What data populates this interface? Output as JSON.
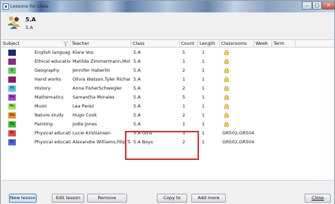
{
  "window": {
    "title": "Lessons for class"
  },
  "header": {
    "title": "5.A",
    "subtitle": "5.A"
  },
  "columns": [
    "Subject",
    "Teacher",
    "Class",
    "Count",
    "Length",
    "Classrooms",
    "Week",
    "Term"
  ],
  "rows": [
    {
      "abbr": "",
      "color": "#1a2b7a",
      "subject": "English language",
      "teacher": "Klara Vos",
      "class": "5.A",
      "count": "5",
      "length": "1",
      "classrooms": ""
    },
    {
      "abbr": "",
      "color": "#8a2a8a",
      "subject": "Ethical education",
      "teacher": "Matilda Zimmermann,Mollie ...",
      "class": "5.A",
      "count": "1",
      "length": "1",
      "classrooms": ""
    },
    {
      "abbr": "G",
      "color": "#5bd05b",
      "subject": "Geography",
      "teacher": "Jennifer Haberlin",
      "class": "5.A",
      "count": "2",
      "length": "1",
      "classrooms": ""
    },
    {
      "abbr": "",
      "color": "#8a1a6a",
      "subject": "Hand works",
      "teacher": "Olivia Watson,Tyler Richards",
      "class": "5.A",
      "count": "1",
      "length": "1",
      "classrooms": ""
    },
    {
      "abbr": "Hi",
      "color": "#48c8e8",
      "subject": "History",
      "teacher": "Anna FisherSchwegler",
      "class": "5.A",
      "count": "2",
      "length": "1",
      "classrooms": ""
    },
    {
      "abbr": "Ma",
      "color": "#b040d8",
      "subject": "Mathematics",
      "teacher": "Samantha Morales",
      "class": "5.A",
      "count": "5",
      "length": "1",
      "classrooms": ""
    },
    {
      "abbr": "Mu",
      "color": "#9aea5a",
      "subject": "Music",
      "teacher": "Lea Perez",
      "class": "5.A",
      "count": "1",
      "length": "1",
      "classrooms": ""
    },
    {
      "abbr": "Na",
      "color": "#f08a20",
      "subject": "Nature study",
      "teacher": "Hugo Cook",
      "class": "5.A",
      "count": "2",
      "length": "1",
      "classrooms": ""
    },
    {
      "abbr": "Pa",
      "color": "#30c030",
      "subject": "Painting",
      "teacher": "Jodie Jones",
      "class": "5.A",
      "count": "1",
      "length": "1",
      "classrooms": ""
    },
    {
      "abbr": "Ph",
      "color": "#e84a4a",
      "subject": "Physical education",
      "teacher": "Lucie Kristiansen",
      "class": "5.A Girls",
      "count": "3",
      "length": "1",
      "classrooms": "GR502,GR504"
    },
    {
      "abbr": "Ph",
      "color": "#4a6ae8",
      "subject": "Physical education",
      "teacher": "Alexandre Williams,Filip Taylo",
      "class": "5.A Boys",
      "count": "2",
      "length": "1",
      "classrooms": "GR502,GR504"
    }
  ],
  "buttons": {
    "new_lesson": "New lesson",
    "edit_lesson": "Edit lesson",
    "remove": "Remove",
    "copy_to": "Copy to",
    "add_more": "Add more",
    "close": "Close"
  },
  "icons": {
    "window": "window-icon",
    "classes": "group-avatar-icon",
    "filter": "filter-icon",
    "classroom_lock": "lock-icon"
  }
}
